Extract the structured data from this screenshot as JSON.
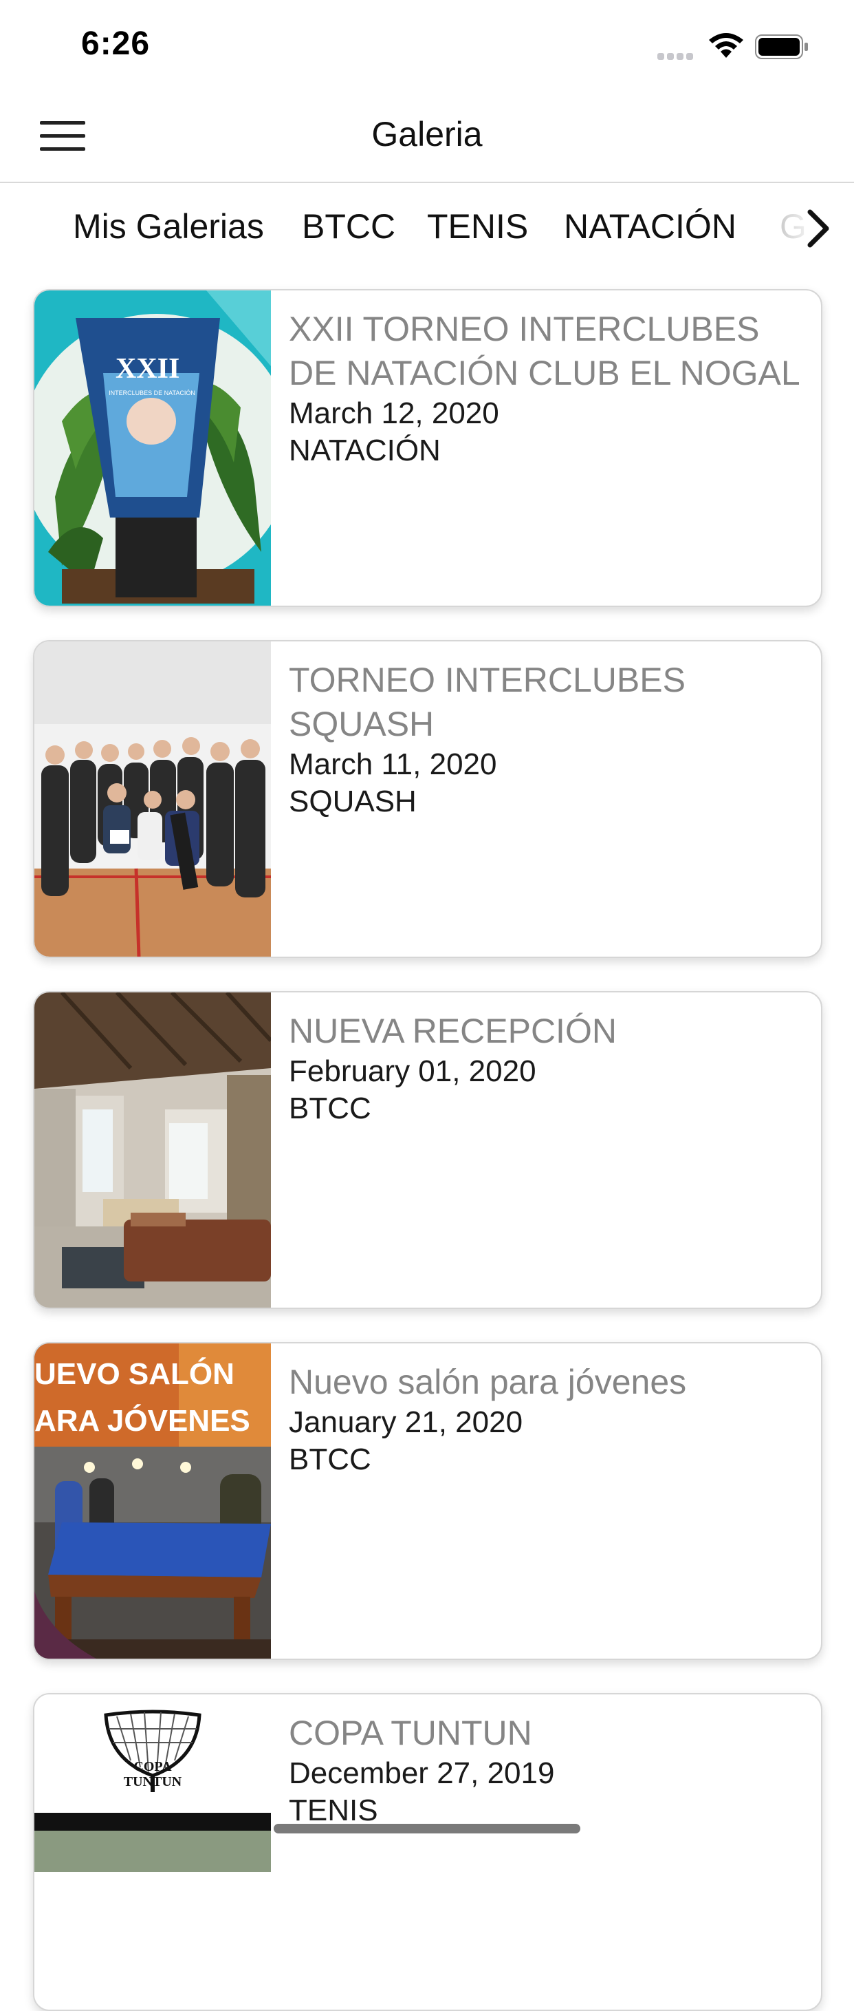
{
  "status_bar": {
    "time": "6:26"
  },
  "nav": {
    "title": "Galeria",
    "menu_icon": "hamburger-menu-icon"
  },
  "tabs": [
    {
      "label": "Mis Galerias"
    },
    {
      "label": "BTCC"
    },
    {
      "label": "TENIS"
    },
    {
      "label": "NATACIÓN"
    },
    {
      "label": "G"
    }
  ],
  "tabs_next_icon": "chevron-right-icon",
  "galleries": [
    {
      "title": "XXII TORNEO INTERCLUBES DE NATACIÓN CLUB EL NOGAL",
      "date": "March 12, 2020",
      "category": "NATACIÓN",
      "thumb_badge": "XXII",
      "thumb_small": "INTERCLUBES DE NATACIÓN"
    },
    {
      "title": "TORNEO INTERCLUBES SQUASH",
      "date": "March 11, 2020",
      "category": "SQUASH"
    },
    {
      "title": "NUEVA RECEPCIÓN",
      "date": "February 01, 2020",
      "category": "BTCC"
    },
    {
      "title": "Nuevo salón para jóvenes",
      "date": "January 21, 2020",
      "category": "BTCC",
      "thumb_line1": "UEVO SALÓN",
      "thumb_line2": "ARA JÓVENES"
    },
    {
      "title": "COPA TUNTUN",
      "date": "December 27, 2019",
      "category": "TENIS",
      "thumb_logo_line1": "COPA",
      "thumb_logo_line2": "TUNTUN"
    }
  ],
  "colors": {
    "title_gray": "#858585",
    "card_border": "#d6d6d6",
    "teal": "#1fb7c4",
    "pool_blue": "#2a55b8",
    "orange": "#d9661f"
  }
}
